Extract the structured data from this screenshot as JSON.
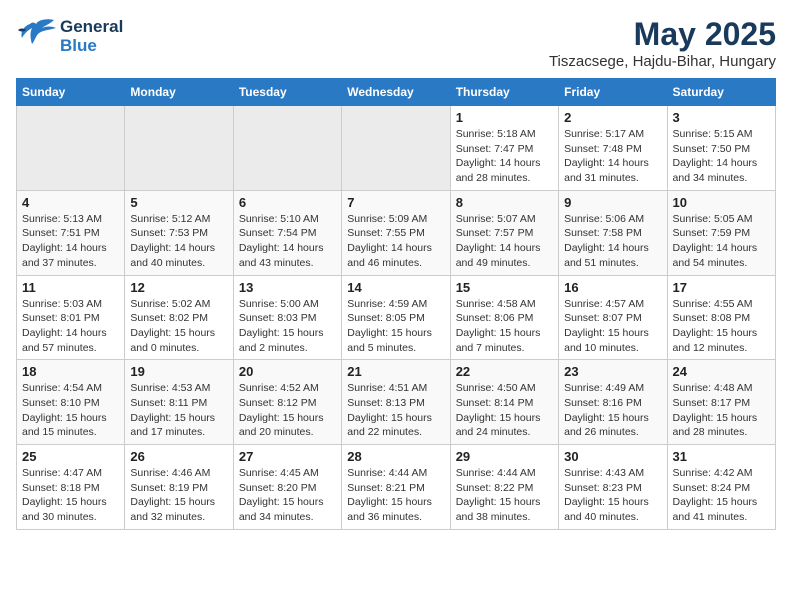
{
  "header": {
    "logo_line1": "General",
    "logo_line2": "Blue",
    "title": "May 2025",
    "subtitle": "Tiszacsege, Hajdu-Bihar, Hungary"
  },
  "weekdays": [
    "Sunday",
    "Monday",
    "Tuesday",
    "Wednesday",
    "Thursday",
    "Friday",
    "Saturday"
  ],
  "weeks": [
    [
      {
        "day": "",
        "info": ""
      },
      {
        "day": "",
        "info": ""
      },
      {
        "day": "",
        "info": ""
      },
      {
        "day": "",
        "info": ""
      },
      {
        "day": "1",
        "info": "Sunrise: 5:18 AM\nSunset: 7:47 PM\nDaylight: 14 hours\nand 28 minutes."
      },
      {
        "day": "2",
        "info": "Sunrise: 5:17 AM\nSunset: 7:48 PM\nDaylight: 14 hours\nand 31 minutes."
      },
      {
        "day": "3",
        "info": "Sunrise: 5:15 AM\nSunset: 7:50 PM\nDaylight: 14 hours\nand 34 minutes."
      }
    ],
    [
      {
        "day": "4",
        "info": "Sunrise: 5:13 AM\nSunset: 7:51 PM\nDaylight: 14 hours\nand 37 minutes."
      },
      {
        "day": "5",
        "info": "Sunrise: 5:12 AM\nSunset: 7:53 PM\nDaylight: 14 hours\nand 40 minutes."
      },
      {
        "day": "6",
        "info": "Sunrise: 5:10 AM\nSunset: 7:54 PM\nDaylight: 14 hours\nand 43 minutes."
      },
      {
        "day": "7",
        "info": "Sunrise: 5:09 AM\nSunset: 7:55 PM\nDaylight: 14 hours\nand 46 minutes."
      },
      {
        "day": "8",
        "info": "Sunrise: 5:07 AM\nSunset: 7:57 PM\nDaylight: 14 hours\nand 49 minutes."
      },
      {
        "day": "9",
        "info": "Sunrise: 5:06 AM\nSunset: 7:58 PM\nDaylight: 14 hours\nand 51 minutes."
      },
      {
        "day": "10",
        "info": "Sunrise: 5:05 AM\nSunset: 7:59 PM\nDaylight: 14 hours\nand 54 minutes."
      }
    ],
    [
      {
        "day": "11",
        "info": "Sunrise: 5:03 AM\nSunset: 8:01 PM\nDaylight: 14 hours\nand 57 minutes."
      },
      {
        "day": "12",
        "info": "Sunrise: 5:02 AM\nSunset: 8:02 PM\nDaylight: 15 hours\nand 0 minutes."
      },
      {
        "day": "13",
        "info": "Sunrise: 5:00 AM\nSunset: 8:03 PM\nDaylight: 15 hours\nand 2 minutes."
      },
      {
        "day": "14",
        "info": "Sunrise: 4:59 AM\nSunset: 8:05 PM\nDaylight: 15 hours\nand 5 minutes."
      },
      {
        "day": "15",
        "info": "Sunrise: 4:58 AM\nSunset: 8:06 PM\nDaylight: 15 hours\nand 7 minutes."
      },
      {
        "day": "16",
        "info": "Sunrise: 4:57 AM\nSunset: 8:07 PM\nDaylight: 15 hours\nand 10 minutes."
      },
      {
        "day": "17",
        "info": "Sunrise: 4:55 AM\nSunset: 8:08 PM\nDaylight: 15 hours\nand 12 minutes."
      }
    ],
    [
      {
        "day": "18",
        "info": "Sunrise: 4:54 AM\nSunset: 8:10 PM\nDaylight: 15 hours\nand 15 minutes."
      },
      {
        "day": "19",
        "info": "Sunrise: 4:53 AM\nSunset: 8:11 PM\nDaylight: 15 hours\nand 17 minutes."
      },
      {
        "day": "20",
        "info": "Sunrise: 4:52 AM\nSunset: 8:12 PM\nDaylight: 15 hours\nand 20 minutes."
      },
      {
        "day": "21",
        "info": "Sunrise: 4:51 AM\nSunset: 8:13 PM\nDaylight: 15 hours\nand 22 minutes."
      },
      {
        "day": "22",
        "info": "Sunrise: 4:50 AM\nSunset: 8:14 PM\nDaylight: 15 hours\nand 24 minutes."
      },
      {
        "day": "23",
        "info": "Sunrise: 4:49 AM\nSunset: 8:16 PM\nDaylight: 15 hours\nand 26 minutes."
      },
      {
        "day": "24",
        "info": "Sunrise: 4:48 AM\nSunset: 8:17 PM\nDaylight: 15 hours\nand 28 minutes."
      }
    ],
    [
      {
        "day": "25",
        "info": "Sunrise: 4:47 AM\nSunset: 8:18 PM\nDaylight: 15 hours\nand 30 minutes."
      },
      {
        "day": "26",
        "info": "Sunrise: 4:46 AM\nSunset: 8:19 PM\nDaylight: 15 hours\nand 32 minutes."
      },
      {
        "day": "27",
        "info": "Sunrise: 4:45 AM\nSunset: 8:20 PM\nDaylight: 15 hours\nand 34 minutes."
      },
      {
        "day": "28",
        "info": "Sunrise: 4:44 AM\nSunset: 8:21 PM\nDaylight: 15 hours\nand 36 minutes."
      },
      {
        "day": "29",
        "info": "Sunrise: 4:44 AM\nSunset: 8:22 PM\nDaylight: 15 hours\nand 38 minutes."
      },
      {
        "day": "30",
        "info": "Sunrise: 4:43 AM\nSunset: 8:23 PM\nDaylight: 15 hours\nand 40 minutes."
      },
      {
        "day": "31",
        "info": "Sunrise: 4:42 AM\nSunset: 8:24 PM\nDaylight: 15 hours\nand 41 minutes."
      }
    ]
  ]
}
